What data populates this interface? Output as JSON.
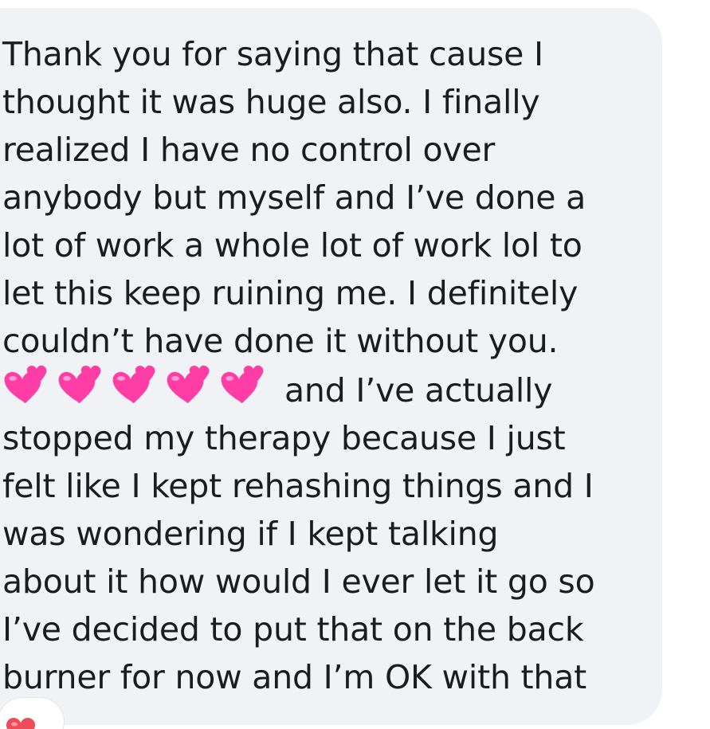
{
  "message": {
    "lines_before_emoji": [
      "Thank you for saying that cause I",
      "thought it was huge also. I finally",
      "realized I have no control over",
      "anybody but myself and I’ve done a",
      "lot of work a whole lot of work lol to",
      "let this keep ruining me. I definitely",
      "couldn’t have done it without you."
    ],
    "emoji_line_text": "and I’ve actually",
    "lines_after_emoji": [
      "stopped my therapy because I just",
      "felt like I kept rehashing things and I",
      "was wondering if I kept talking",
      "about it how would I ever let it go so",
      "I’ve decided to put that on the back",
      "burner for now and I’m OK with that"
    ],
    "emoji": {
      "name": "two-hearts-icon",
      "count": 5
    }
  },
  "reaction": {
    "icon": "heart-reaction-icon",
    "color": "#ef4c5a"
  },
  "colors": {
    "bubble_background": "#f1f2f6",
    "text": "#1c1c1e",
    "emoji_pink": "#ff3ea5"
  }
}
